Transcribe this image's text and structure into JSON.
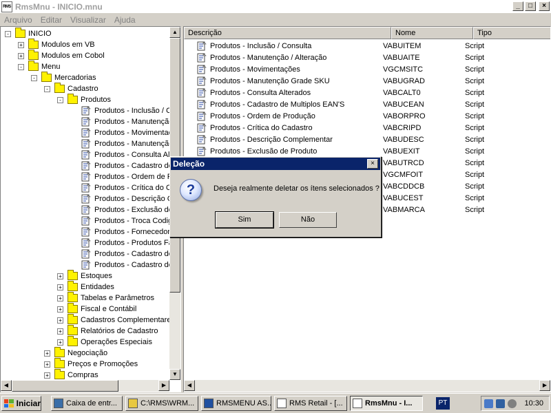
{
  "window": {
    "title": "RmsMnu - INICIO.mnu",
    "icon_text": "RMS",
    "controls": {
      "minimize": "_",
      "maximize": "□",
      "close": "×"
    }
  },
  "menubar": [
    "Arquivo",
    "Editar",
    "Visualizar",
    "Ajuda"
  ],
  "tree": [
    {
      "label": "INICIO",
      "level": 0,
      "expander": "-",
      "icon": "folder"
    },
    {
      "label": "Modulos em VB",
      "level": 1,
      "expander": "+",
      "icon": "folder"
    },
    {
      "label": "Modulos em Cobol",
      "level": 1,
      "expander": "+",
      "icon": "folder"
    },
    {
      "label": "Menu",
      "level": 1,
      "expander": "-",
      "icon": "folder"
    },
    {
      "label": "Mercadorias",
      "level": 2,
      "expander": "-",
      "icon": "folder"
    },
    {
      "label": "Cadastro",
      "level": 3,
      "expander": "-",
      "icon": "folder"
    },
    {
      "label": "Produtos",
      "level": 4,
      "expander": "-",
      "icon": "folder-open"
    },
    {
      "label": "Produtos - Inclusão / Consulta",
      "level": 5,
      "expander": "",
      "icon": "script"
    },
    {
      "label": "Produtos - Manutenção / Alteração",
      "level": 5,
      "expander": "",
      "icon": "script"
    },
    {
      "label": "Produtos - Movimentações",
      "level": 5,
      "expander": "",
      "icon": "script"
    },
    {
      "label": "Produtos - Manutenção Grade SKU",
      "level": 5,
      "expander": "",
      "icon": "script"
    },
    {
      "label": "Produtos - Consulta Alterados",
      "level": 5,
      "expander": "",
      "icon": "script"
    },
    {
      "label": "Produtos - Cadastro de Multiplos EAN'S",
      "level": 5,
      "expander": "",
      "icon": "script"
    },
    {
      "label": "Produtos - Ordem de Produção",
      "level": 5,
      "expander": "",
      "icon": "script"
    },
    {
      "label": "Produtos - Crítica do Cadastro",
      "level": 5,
      "expander": "",
      "icon": "script"
    },
    {
      "label": "Produtos - Descrição Complementar",
      "level": 5,
      "expander": "",
      "icon": "script"
    },
    {
      "label": "Produtos - Exclusão de Produto",
      "level": 5,
      "expander": "",
      "icon": "script"
    },
    {
      "label": "Produtos - Troca Codigo",
      "level": 5,
      "expander": "",
      "icon": "script"
    },
    {
      "label": "Produtos - Fornecedor",
      "level": 5,
      "expander": "",
      "icon": "script"
    },
    {
      "label": "Produtos - Produtos Fa",
      "level": 5,
      "expander": "",
      "icon": "script"
    },
    {
      "label": "Produtos - Cadastro de",
      "level": 5,
      "expander": "",
      "icon": "script"
    },
    {
      "label": "Produtos - Cadastro de",
      "level": 5,
      "expander": "",
      "icon": "script"
    },
    {
      "label": "Estoques",
      "level": 4,
      "expander": "+",
      "icon": "folder"
    },
    {
      "label": "Entidades",
      "level": 4,
      "expander": "+",
      "icon": "folder"
    },
    {
      "label": "Tabelas e Parâmetros",
      "level": 4,
      "expander": "+",
      "icon": "folder"
    },
    {
      "label": "Fiscal e Contábil",
      "level": 4,
      "expander": "+",
      "icon": "folder"
    },
    {
      "label": "Cadastros Complementares",
      "level": 4,
      "expander": "+",
      "icon": "folder"
    },
    {
      "label": "Relatórios de Cadastro",
      "level": 4,
      "expander": "+",
      "icon": "folder"
    },
    {
      "label": "Operações Especiais",
      "level": 4,
      "expander": "+",
      "icon": "folder"
    },
    {
      "label": "Negociação",
      "level": 3,
      "expander": "+",
      "icon": "folder"
    },
    {
      "label": "Preços e Promoções",
      "level": 3,
      "expander": "+",
      "icon": "folder"
    },
    {
      "label": "Compras",
      "level": 3,
      "expander": "+",
      "icon": "folder"
    }
  ],
  "list": {
    "columns": [
      "Descrição",
      "Nome",
      "Tipo"
    ],
    "rows": [
      {
        "desc": "Produtos - Inclusão / Consulta",
        "name": "VABUITEM",
        "tipo": "Script"
      },
      {
        "desc": "Produtos - Manutenção / Alteração",
        "name": "VABUAITE",
        "tipo": "Script"
      },
      {
        "desc": "Produtos - Movimentações",
        "name": "VGCMSITC",
        "tipo": "Script"
      },
      {
        "desc": "Produtos - Manutenção Grade SKU",
        "name": "VABUGRAD",
        "tipo": "Script"
      },
      {
        "desc": "Produtos - Consulta Alterados",
        "name": "VABCALT0",
        "tipo": "Script"
      },
      {
        "desc": "Produtos - Cadastro de Multiplos EAN'S",
        "name": "VABUCEAN",
        "tipo": "Script"
      },
      {
        "desc": "Produtos - Ordem de Produção",
        "name": "VABORPRO",
        "tipo": "Script"
      },
      {
        "desc": "Produtos - Crítica do Cadastro",
        "name": "VABCRIPD",
        "tipo": "Script"
      },
      {
        "desc": "Produtos - Descrição Complementar",
        "name": "VABUDESC",
        "tipo": "Script"
      },
      {
        "desc": "Produtos - Exclusão de Produto",
        "name": "VABUEXIT",
        "tipo": "Script"
      },
      {
        "desc": "",
        "name": "VABUTRCD",
        "tipo": "Script"
      },
      {
        "desc": "",
        "name": "VGCMFOIT",
        "tipo": "Script"
      },
      {
        "desc": "",
        "name": "VABCDDCB",
        "tipo": "Script"
      },
      {
        "desc": "",
        "name": "VABUCEST",
        "tipo": "Script"
      },
      {
        "desc": "",
        "name": "VABMARCA",
        "tipo": "Script"
      }
    ]
  },
  "dialog": {
    "title": "Deleção",
    "message": "Deseja realmente deletar os ítens selecionados ?",
    "icon": "?",
    "yes_label": "Sim",
    "no_label": "Não",
    "close": "×"
  },
  "taskbar": {
    "start_label": "Iniciar",
    "tasks": [
      {
        "label": "Caixa de entr...",
        "icon": "inbox-icon",
        "active": false
      },
      {
        "label": "C:\\RMS\\WRM...",
        "icon": "folder-icon",
        "active": false
      },
      {
        "label": "RMSMENU AS...",
        "icon": "word-icon",
        "active": false
      },
      {
        "label": "RMS Retail - [...",
        "icon": "rms-icon",
        "active": false
      },
      {
        "label": "RmsMnu - I...",
        "icon": "rms-icon",
        "active": true
      }
    ],
    "language": "PT",
    "clock": "10:30"
  }
}
